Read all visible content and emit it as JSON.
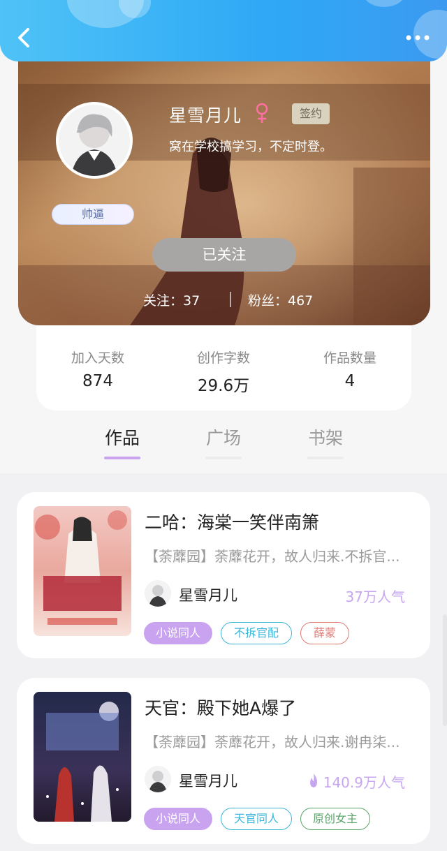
{
  "header": {
    "back_icon": "chevron-left-icon",
    "more_icon": "more-dots-icon"
  },
  "profile": {
    "name": "星雪月儿",
    "gender_icon": "female-icon",
    "sign_badge": "签约",
    "bio": "窝在学校搞学习，不定时登。",
    "title_tag": "帅逼",
    "follow_button": "已关注",
    "following": "关注：37",
    "fans": "粉丝：467"
  },
  "stats": [
    {
      "label": "加入天数",
      "value": "874"
    },
    {
      "label": "创作字数",
      "value": "29.6万"
    },
    {
      "label": "作品数量",
      "value": "4"
    }
  ],
  "tabs": [
    {
      "label": "作品",
      "active": true
    },
    {
      "label": "广场",
      "active": false
    },
    {
      "label": "书架",
      "active": false
    }
  ],
  "works": [
    {
      "title": "二哈：海棠一笑伴南箫",
      "desc": "【荼蘼园】荼蘼花开，故人归来.不拆官...",
      "author": "星雪月儿",
      "popularity": "37万人气",
      "hot": false,
      "tags": [
        "小说同人",
        "不拆官配",
        "薛蒙"
      ]
    },
    {
      "title": "天官：殿下她A爆了",
      "desc": "【荼蘼园】荼蘼花开，故人归来.谢冉柒...",
      "author": "星雪月儿",
      "popularity": "140.9万人气",
      "hot": true,
      "tags": [
        "小说同人",
        "天官同人",
        "原创女主"
      ]
    }
  ],
  "colors": {
    "accent": "#c08af0",
    "header": "#3aa9f3",
    "tab_active": "#c9a3f0"
  }
}
